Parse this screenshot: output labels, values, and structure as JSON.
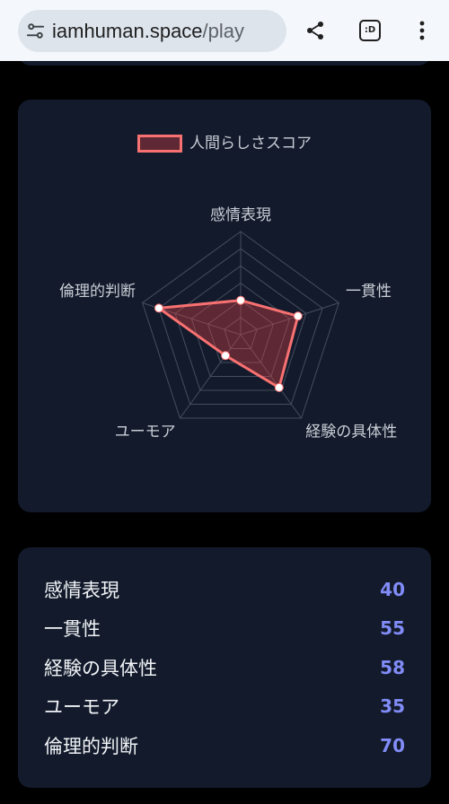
{
  "browser": {
    "url_host": "iamhuman.space",
    "url_path": "/play",
    "tab_switcher_label": ":D",
    "icons": {
      "site_settings": "tune-icon",
      "share": "share-icon",
      "tab_switcher": "tab-switcher-icon",
      "menu": "more-vert-icon"
    }
  },
  "chart_data": {
    "type": "radar",
    "categories": [
      "感情表現",
      "一貫性",
      "経験の具体性",
      "ユーモア",
      "倫理的判断"
    ],
    "series": [
      {
        "name": "人間らしさスコア",
        "values": [
          40,
          55,
          58,
          35,
          70
        ],
        "color": "#f87171"
      }
    ],
    "r_range": [
      20,
      80
    ],
    "grid": true,
    "legend_position": "top"
  },
  "scores": [
    {
      "label": "感情表現",
      "value": 40
    },
    {
      "label": "一貫性",
      "value": 55
    },
    {
      "label": "経験の具体性",
      "value": 58
    },
    {
      "label": "ユーモア",
      "value": 35
    },
    {
      "label": "倫理的判断",
      "value": 70
    }
  ],
  "colors": {
    "page_background": "#000000",
    "card_background": "#121a2b",
    "series_stroke": "#f87171",
    "series_fill": "rgba(239,68,68,0.35)",
    "grid_line": "#464e5e",
    "score_value": "#818cf8"
  }
}
